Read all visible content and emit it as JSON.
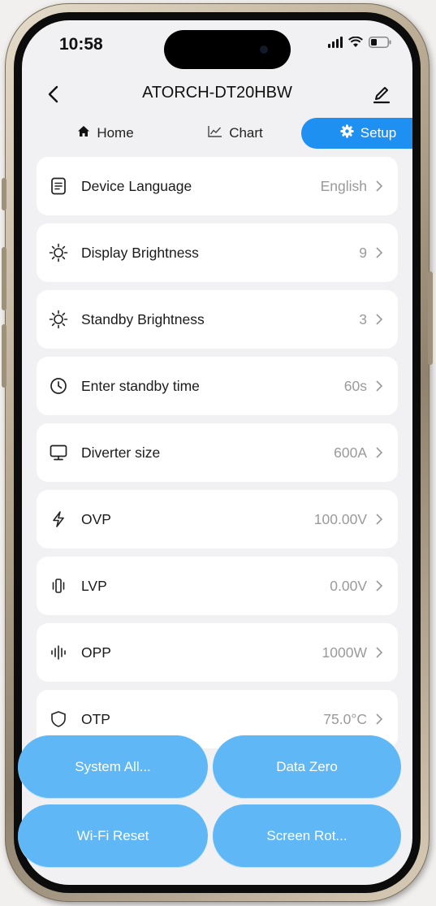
{
  "status": {
    "time": "10:58"
  },
  "header": {
    "title": "ATORCH-DT20HBW"
  },
  "tabs": [
    {
      "label": "Home",
      "icon": "home-icon"
    },
    {
      "label": "Chart",
      "icon": "chart-line-icon"
    },
    {
      "label": "Setup",
      "icon": "gear-icon"
    }
  ],
  "settings": [
    {
      "label": "Device Language",
      "value": "English",
      "icon": "document-icon"
    },
    {
      "label": "Display Brightness",
      "value": "9",
      "icon": "sun-icon"
    },
    {
      "label": "Standby Brightness",
      "value": "3",
      "icon": "sun-icon"
    },
    {
      "label": "Enter standby time",
      "value": "60s",
      "icon": "clock-icon"
    },
    {
      "label": "Diverter size",
      "value": "600A",
      "icon": "monitor-icon"
    },
    {
      "label": "OVP",
      "value": "100.00V",
      "icon": "lightning-icon"
    },
    {
      "label": "LVP",
      "value": "0.00V",
      "icon": "vibration-icon"
    },
    {
      "label": "OPP",
      "value": "1000W",
      "icon": "waveform-icon"
    },
    {
      "label": "OTP",
      "value": "75.0°C",
      "icon": "shield-icon"
    }
  ],
  "actions": [
    {
      "label": "System All..."
    },
    {
      "label": "Data Zero"
    },
    {
      "label": "Wi-Fi Reset"
    },
    {
      "label": "Screen Rot..."
    }
  ],
  "colors": {
    "accent": "#1e90f2",
    "button": "#5fb8f5",
    "row_bg": "#ffffff",
    "value_text": "#9a9a9a"
  }
}
